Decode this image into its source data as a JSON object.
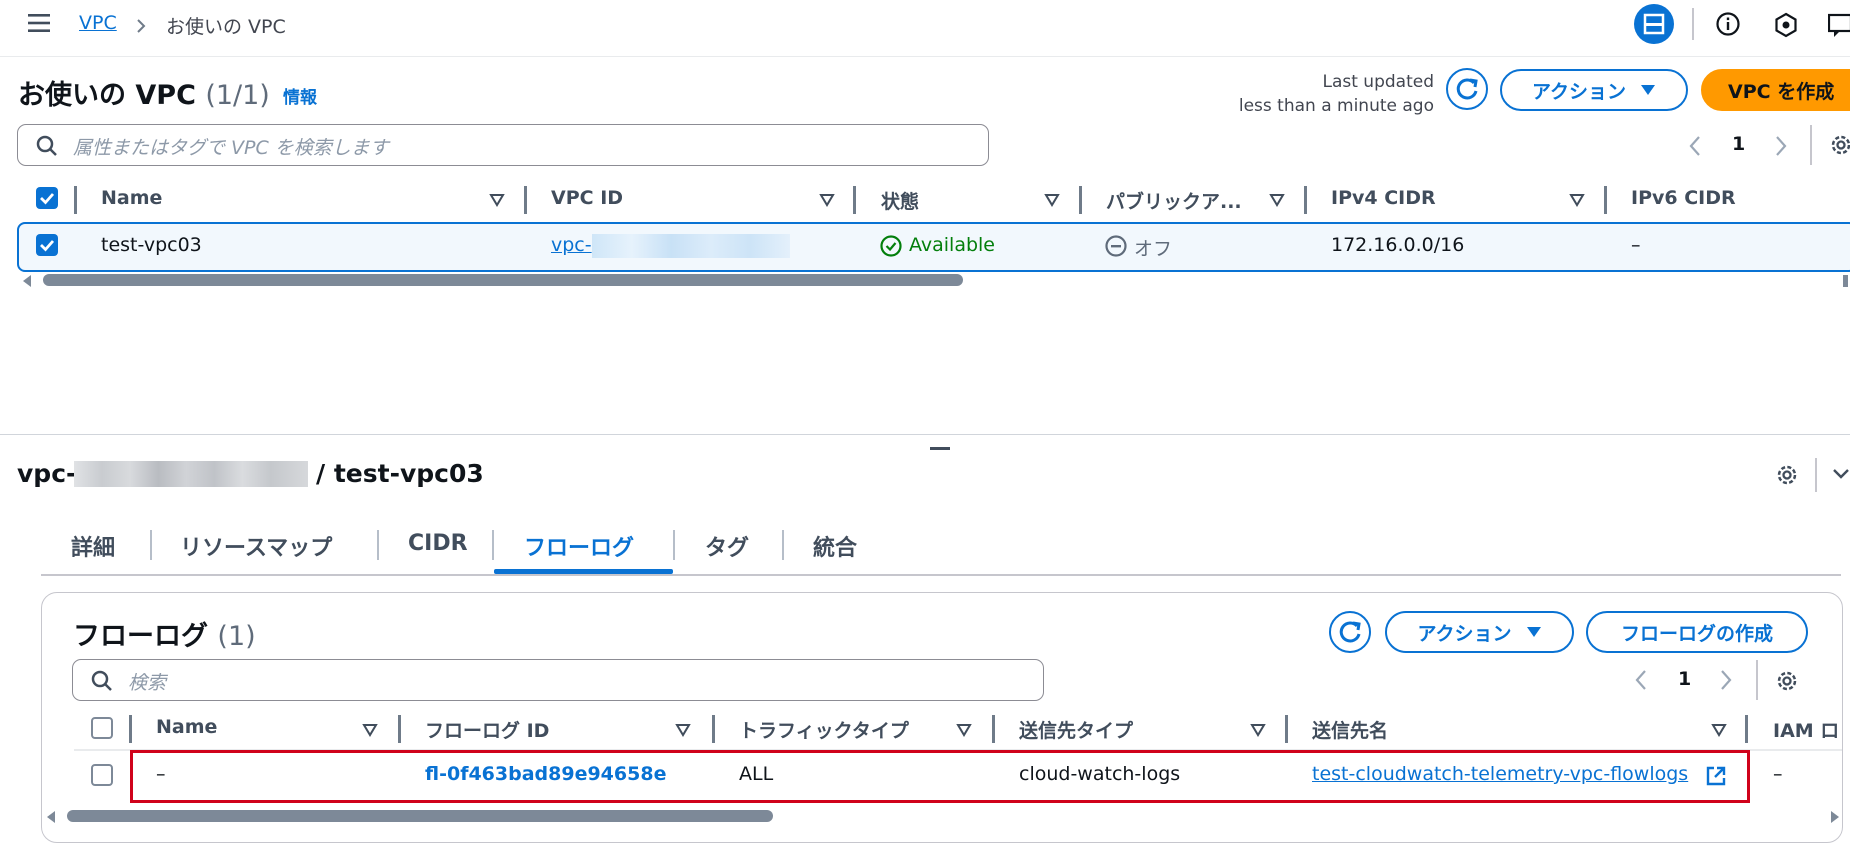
{
  "breadcrumb": {
    "root": "VPC",
    "current": "お使いの VPC"
  },
  "vpc_list": {
    "title": "お使いの VPC",
    "count": "(1/1)",
    "info_link": "情報",
    "last_updated_label": "Last updated",
    "last_updated_value": "less than a minute ago",
    "actions_label": "アクション",
    "create_label": "VPC を作成",
    "search_placeholder": "属性またはタグで VPC を検索します",
    "page_number": "1",
    "columns": [
      "Name",
      "VPC ID",
      "状態",
      "パブリックア...",
      "IPv4 CIDR",
      "IPv6 CIDR"
    ],
    "row": {
      "name": "test-vpc03",
      "vpc_id": "vpc-",
      "state": "Available",
      "public": "オフ",
      "ipv4": "172.16.0.0/16",
      "ipv6": "–"
    }
  },
  "details": {
    "heading_prefix": "vpc-",
    "heading_suffix": "/ test-vpc03",
    "tabs": [
      "詳細",
      "リソースマップ",
      "CIDR",
      "フローログ",
      "タグ",
      "統合"
    ],
    "active_tab": "フローログ"
  },
  "flow_logs": {
    "title": "フローログ",
    "count": "(1)",
    "actions_label": "アクション",
    "create_label": "フローログの作成",
    "search_placeholder": "検索",
    "page_number": "1",
    "columns": [
      "Name",
      "フローログ ID",
      "トラフィックタイプ",
      "送信先タイプ",
      "送信先名",
      "IAM ロ"
    ],
    "row": {
      "name": "–",
      "id": "fl-0f463bad89e94658e",
      "traffic": "ALL",
      "dest_type": "cloud-watch-logs",
      "dest_name": "test-cloudwatch-telemetry-vpc-flowlogs",
      "iam": "–"
    }
  },
  "colors": {
    "accent": "#0972d3",
    "primary_button": "#ff9900",
    "success": "#037f0c",
    "highlight_border": "#d0021b"
  }
}
